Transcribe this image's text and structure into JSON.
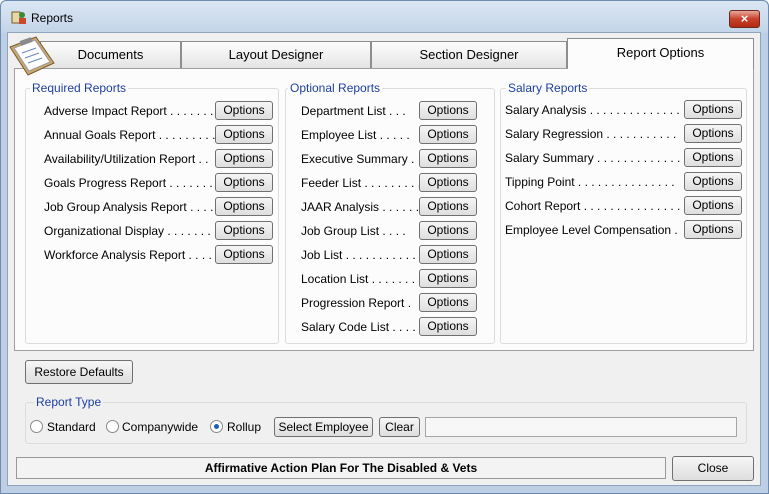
{
  "window": {
    "title": "Reports",
    "close_glyph": "×"
  },
  "tabs": [
    "Documents",
    "Layout Designer",
    "Section Designer",
    "Report Options"
  ],
  "active_tab": "Report Options",
  "required": {
    "title": "Required Reports",
    "items": [
      "Adverse Impact Report . . . . . . .",
      "Annual Goals Report . . . . . . . . .",
      "Availability/Utilization Report . .",
      "Goals Progress Report . . . . . . .",
      "Job Group Analysis Report . . . .",
      "Organizational Display . . . . . . . .",
      "Workforce Analysis Report . . . ."
    ]
  },
  "optional": {
    "title": "Optional Reports",
    "items": [
      "Department List . . .",
      "Employee List . . . . .",
      "Executive Summary .",
      "Feeder List . . . . . . . . .",
      "JAAR Analysis . . . . . .",
      "Job Group List . . . .",
      "Job List . . . . . . . . . . .",
      "Location List . . . . . . .",
      "Progression Report .",
      "Salary Code List . . . ."
    ]
  },
  "salary": {
    "title": "Salary Reports",
    "items": [
      "Salary Analysis . . . . . . . . . . . . . .",
      "Salary Regression . . . . . . . . . . .",
      "Salary Summary . . . . . . . . . . . . .",
      "Tipping Point . . . . . . . . . . . . . . .",
      "Cohort Report . . . . . . . . . . . . . . .",
      "Employee Level Compensation ."
    ]
  },
  "options_label": "Options",
  "restore_defaults": "Restore Defaults",
  "report_type": {
    "title": "Report Type",
    "options": [
      "Standard",
      "Companywide",
      "Rollup"
    ],
    "selected": "Rollup",
    "select_employee": "Select Employee",
    "clear": "Clear",
    "employee_value": ""
  },
  "status_text": "Affirmative Action Plan For The Disabled & Vets",
  "close_button": "Close"
}
